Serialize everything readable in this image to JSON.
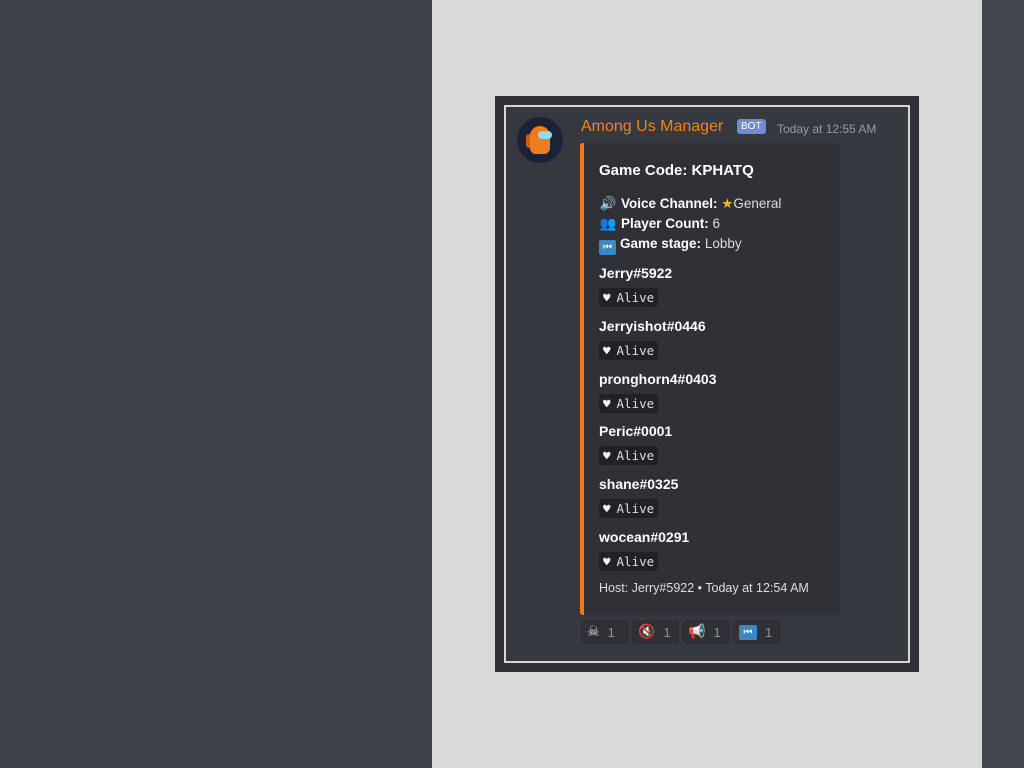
{
  "message": {
    "username": "Among Us Manager",
    "bot_tag": "BOT",
    "timestamp": "Today at 12:55 AM"
  },
  "embed": {
    "accent_color": "#f07d1b",
    "title": "Game Code: KPHATQ",
    "voice_channel": {
      "label": "Voice Channel:",
      "emoji": "star",
      "value": "General"
    },
    "player_count": {
      "label": "Player Count:",
      "value": "6"
    },
    "game_stage": {
      "label": "Game stage:",
      "value": "Lobby"
    },
    "players": [
      {
        "name": "Jerry#5922",
        "status": "Alive"
      },
      {
        "name": "Jerryishot#0446",
        "status": "Alive"
      },
      {
        "name": "pronghorn4#0403",
        "status": "Alive"
      },
      {
        "name": "Peric#0001",
        "status": "Alive"
      },
      {
        "name": "shane#0325",
        "status": "Alive"
      },
      {
        "name": "wocean#0291",
        "status": "Alive"
      }
    ],
    "footer": "Host: Jerry#5922 • Today at 12:54 AM"
  },
  "reactions": [
    {
      "icon": "skull-crossbones-icon",
      "count": "1"
    },
    {
      "icon": "muted-speaker-icon",
      "count": "1"
    },
    {
      "icon": "megaphone-icon",
      "count": "1"
    },
    {
      "icon": "rewind-icon",
      "count": "1"
    }
  ]
}
